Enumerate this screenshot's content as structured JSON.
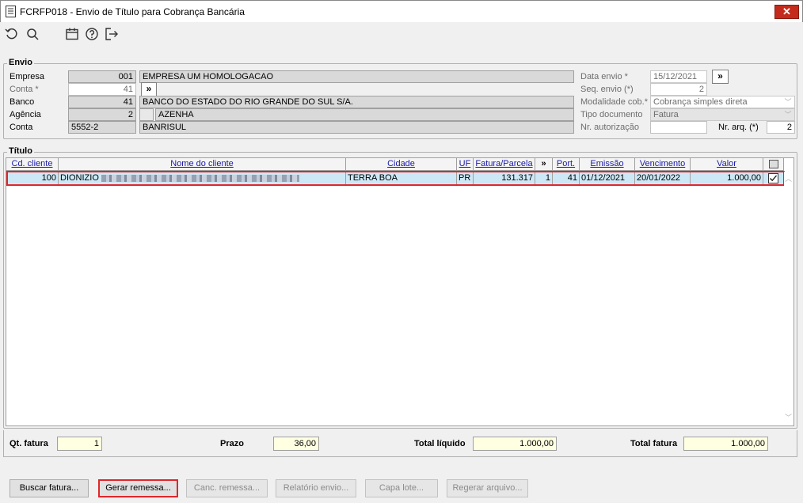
{
  "window": {
    "title": "FCRFP018 - Envio de Título para Cobrança Bancária",
    "close_label": "✕"
  },
  "toolbar": {
    "icons": [
      "undo-icon",
      "search-icon",
      "calendar-icon",
      "help-icon",
      "exit-icon"
    ]
  },
  "envio": {
    "legend": "Envio",
    "empresa": {
      "label": "Empresa",
      "code": "001",
      "name": "EMPRESA UM HOMOLOGACAO"
    },
    "conta_row": {
      "label": "Conta *",
      "value": "41",
      "btn": "»"
    },
    "banco": {
      "label": "Banco",
      "code": "41",
      "name": "BANCO DO ESTADO DO RIO GRANDE DO SUL S/A."
    },
    "agencia": {
      "label": "Agência",
      "code": "2",
      "name": "AZENHA"
    },
    "conta": {
      "label": "Conta",
      "code": "5552-2",
      "name": "BANRISUL"
    },
    "data_envio": {
      "label": "Data envio *",
      "value": "15/12/2021",
      "btn": "»"
    },
    "seq_envio": {
      "label": "Seq. envio (*)",
      "value": "2"
    },
    "modalidade": {
      "label": "Modalidade cob.*",
      "value": "Cobrança simples direta"
    },
    "tipo_documento": {
      "label": "Tipo documento",
      "value": "Fatura"
    },
    "nr_autorizacao": {
      "label": "Nr. autorização",
      "value": ""
    },
    "nr_arq": {
      "label": "Nr. arq. (*)",
      "value": "2"
    }
  },
  "titulo": {
    "legend": "Título",
    "columns": [
      "Cd. cliente",
      "Nome do cliente",
      "Cidade",
      "UF",
      "Fatura/Parcela",
      "»",
      "Port.",
      "Emissão",
      "Vencimento",
      "Valor",
      ""
    ],
    "rows": [
      {
        "cd": "100",
        "nome": "DIONIZIO",
        "cidade": "TERRA BOA",
        "uf": "PR",
        "fatura": "131.317",
        "parcela": "1",
        "port": "41",
        "emissao": "01/12/2021",
        "vencimento": "20/01/2022",
        "valor": "1.000,00",
        "checked": true
      }
    ]
  },
  "totals": {
    "qt_fatura": {
      "label": "Qt. fatura",
      "value": "1"
    },
    "prazo": {
      "label": "Prazo",
      "value": "36,00"
    },
    "total_liquido": {
      "label": "Total líquido",
      "value": "1.000,00"
    },
    "total_fatura": {
      "label": "Total fatura",
      "value": "1.000,00"
    }
  },
  "buttons": {
    "buscar": "Buscar fatura...",
    "gerar": "Gerar remessa...",
    "canc": "Canc. remessa...",
    "relatorio": "Relatório envio...",
    "capa": "Capa lote...",
    "regerar": "Regerar arquivo..."
  },
  "colors": {
    "highlight_border": "#e0262b",
    "selected_row": "#cce8f6",
    "yellow_field": "#ffffe1",
    "header_text": "#1a1aa6"
  }
}
